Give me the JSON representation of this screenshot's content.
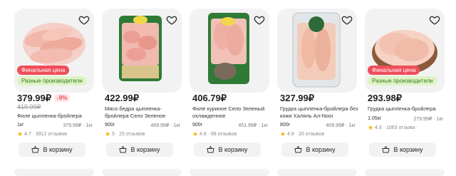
{
  "products": [
    {
      "price": "379.99₽",
      "old_price": "419.99₽",
      "discount": "-9%",
      "badge_red": "Финальная цена",
      "badge_green": "Разные производители",
      "name": "Филе цыпленка-бройлера",
      "weight": "1кг",
      "unit_price": "379.99₽ · 1кг",
      "rating": "4.7",
      "reviews": "3912 отзывов",
      "cart_label": "В корзину"
    },
    {
      "price": "422.99₽",
      "name": "Мясо бедра цыпленка-бройлера Село Зеленое",
      "weight": "900г",
      "unit_price": "469.99₽ · 1кг",
      "rating": "5",
      "reviews": "25 отзывов",
      "cart_label": "В корзину"
    },
    {
      "price": "406.79₽",
      "name": "Филе куриное Село Зеленый охлажденное",
      "weight": "900г",
      "unit_price": "451.99₽ · 1кг",
      "rating": "4.8",
      "reviews": "68 отзывов",
      "cart_label": "В корзину"
    },
    {
      "price": "327.99₽",
      "name": "Грудка цыпленка-бройлера без кожи Халяль Ал-Noor",
      "weight": "800г",
      "unit_price": "409.99₽ · 1кг",
      "rating": "4.8",
      "reviews": "20 отзывов",
      "cart_label": "В корзину"
    },
    {
      "price": "293.98₽",
      "badge_red": "Финальная цена",
      "badge_green": "Разные производители",
      "name": "Грудка цыпленка-бройлера",
      "weight": "1.05кг",
      "unit_price": "279.99₽ · 1кг",
      "rating": "4.9",
      "reviews": "1063 отзыва",
      "cart_label": "В корзину"
    }
  ],
  "colors": {
    "discount": "#ef4d5a",
    "star": "#f5b400",
    "producer_badge": "#dff3c6"
  }
}
